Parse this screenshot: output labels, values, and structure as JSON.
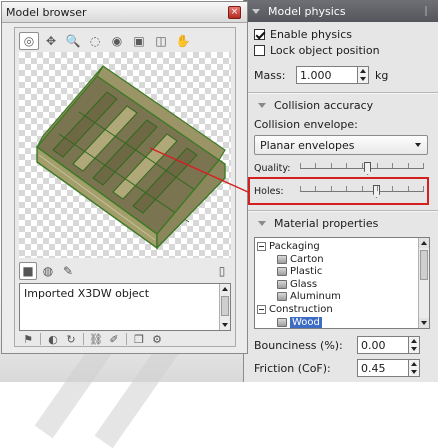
{
  "browser": {
    "title": "Model browser",
    "close_glyph": "×",
    "toolbar": [
      {
        "name": "view-icon",
        "glyph": "◎",
        "active": true
      },
      {
        "name": "move-icon",
        "glyph": "✥"
      },
      {
        "name": "zoom-icon",
        "glyph": "🔍"
      },
      {
        "name": "rotate-icon",
        "glyph": "◌"
      },
      {
        "name": "target-icon",
        "glyph": "◉"
      },
      {
        "name": "frame-icon",
        "glyph": "▣"
      },
      {
        "name": "camera-icon",
        "glyph": "◫"
      },
      {
        "name": "hand-icon",
        "glyph": "✋"
      }
    ],
    "mid_icons": [
      {
        "name": "crate-icon",
        "glyph": "■",
        "active": true
      },
      {
        "name": "texture-icon",
        "glyph": "◍"
      },
      {
        "name": "edit-icon",
        "glyph": "✎"
      },
      {
        "name": "new-doc-icon",
        "glyph": "▯"
      }
    ],
    "description": "Imported X3DW object",
    "bottom_icons": [
      {
        "name": "flag-icon",
        "glyph": "⚑"
      },
      {
        "name": "half-circle-icon",
        "glyph": "◐"
      },
      {
        "name": "refresh-icon",
        "glyph": "↻"
      },
      {
        "name": "link-icon",
        "glyph": "⛓"
      },
      {
        "name": "brush-icon",
        "glyph": "✐"
      },
      {
        "name": "duplicate-icon",
        "glyph": "❐"
      },
      {
        "name": "settings-icon",
        "glyph": "⚙"
      }
    ]
  },
  "physics": {
    "section_title": "Model physics",
    "enable_label": "Enable physics",
    "enable_checked": true,
    "lock_label": "Lock object position",
    "lock_checked": false,
    "mass_label": "Mass:",
    "mass_value": "1.000",
    "mass_unit": "kg",
    "collision_title": "Collision accuracy",
    "envelope_label": "Collision envelope:",
    "envelope_value": "Planar envelopes",
    "quality_label": "Quality:",
    "quality_level": 0.55,
    "holes_label": "Holes:",
    "holes_level": 0.62,
    "material_title": "Material properties",
    "materials": [
      {
        "label": "Packaging",
        "kind": "group",
        "level": 0
      },
      {
        "label": "Carton",
        "kind": "item",
        "level": 1
      },
      {
        "label": "Plastic",
        "kind": "item",
        "level": 1
      },
      {
        "label": "Glass",
        "kind": "item",
        "level": 1
      },
      {
        "label": "Aluminum",
        "kind": "item",
        "level": 1
      },
      {
        "label": "Construction",
        "kind": "group",
        "level": 0
      },
      {
        "label": "Wood",
        "kind": "item",
        "level": 1,
        "selected": true
      }
    ],
    "bounciness_label": "Bounciness (%):",
    "bounciness_value": "0.00",
    "friction_label": "Friction (CoF):",
    "friction_value": "0.45"
  },
  "colors": {
    "highlight": "#d61f1f",
    "selection": "#3d6cc4",
    "crate_wood": "#8a8458",
    "crate_edge": "#3c7a24"
  }
}
